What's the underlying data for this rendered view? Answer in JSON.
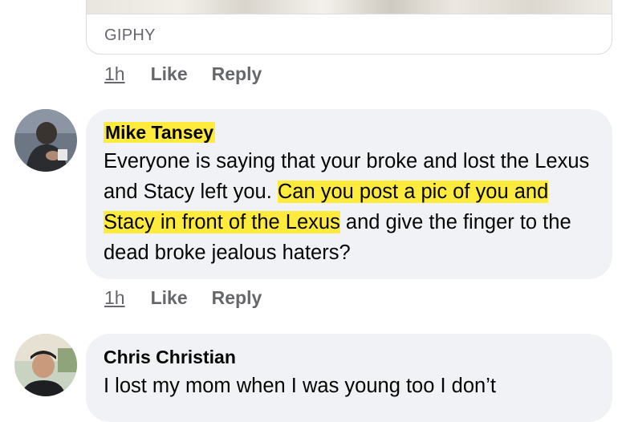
{
  "giphy": {
    "label": "GIPHY"
  },
  "comment_actions_1": {
    "time": "1h",
    "like": "Like",
    "reply": "Reply"
  },
  "comment_1": {
    "author": "Mike Tansey",
    "text_part1": "Everyone is saying that your broke and lost the Lexus and Stacy left you. ",
    "text_highlight": "Can you post a pic of you and Stacy in front of the Lexus",
    "text_part2": " and give the finger to the dead broke jealous haters?",
    "highlight_color": "#ffeb3b"
  },
  "comment_actions_2": {
    "time": "1h",
    "like": "Like",
    "reply": "Reply"
  },
  "comment_2": {
    "author": "Chris Christian",
    "text": "I lost my mom when I was young too I don’t"
  },
  "colors": {
    "bubble": "#f0f2f5",
    "secondary_text": "#65676b",
    "text": "#050505"
  }
}
